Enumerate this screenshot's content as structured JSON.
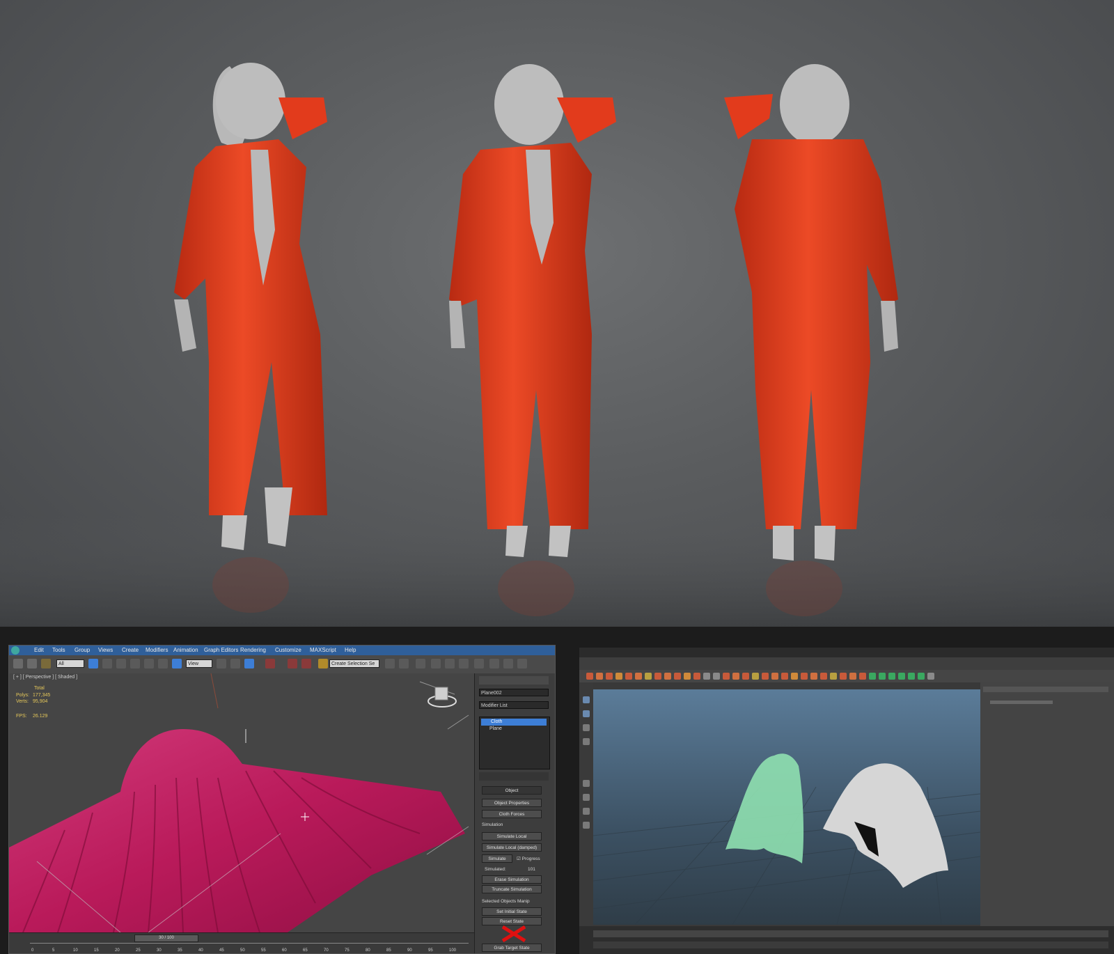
{
  "max_app": {
    "menu": [
      "Edit",
      "Tools",
      "Group",
      "Views",
      "Create",
      "Modifiers",
      "Animation",
      "Graph Editors",
      "Rendering",
      "Customize",
      "MAXScript",
      "Help"
    ],
    "toolbar": {
      "filter_value": "All",
      "ref_coord_value": "View",
      "selection_set_placeholder": "Create Selection Se"
    },
    "viewport": {
      "label": "[ + ] [ Perspective ] [ Shaded ]",
      "stats": {
        "total_label": "Total",
        "polys_label": "Polys:",
        "polys_value": "177,345",
        "verts_label": "Verts:",
        "verts_value": "95,904",
        "fps_label": "FPS:",
        "fps_value": "26.129"
      }
    },
    "command_panel": {
      "object_name": "Plane002",
      "modifier_list_label": "Modifier List",
      "stack": [
        "Cloth",
        "Plane"
      ],
      "rollout_title": "Object",
      "buttons_object": [
        "Object Properties",
        "Cloth Forces"
      ],
      "simulation_label": "Simulation",
      "buttons_sim": [
        "Simulate Local",
        "Simulate Local (damped)"
      ],
      "simulate_button": "Simulate",
      "progress_label": "Progress",
      "simulated_label": "Simulated:",
      "simulated_value": "101",
      "buttons_sim2": [
        "Erase Simulation",
        "Truncate Simulation"
      ],
      "manip_label": "Selected Objects Manip",
      "buttons_manip": [
        "Set Initial State",
        "Reset State",
        "Grab Target State"
      ]
    },
    "timeline": {
      "frame_display": "30 / 100",
      "ticks": [
        "0",
        "5",
        "10",
        "15",
        "20",
        "25",
        "30",
        "35",
        "40",
        "45",
        "50",
        "55",
        "60",
        "65",
        "70",
        "75",
        "80",
        "85",
        "90",
        "95",
        "100"
      ]
    }
  },
  "colors": {
    "jumpsuit": "#e23b1c",
    "mannequin": "#b8b8b8",
    "max_cloth": "#c21f63",
    "maya_cloth_green": "#8fe0b0",
    "maya_cloth_white": "#d6d6d6"
  }
}
